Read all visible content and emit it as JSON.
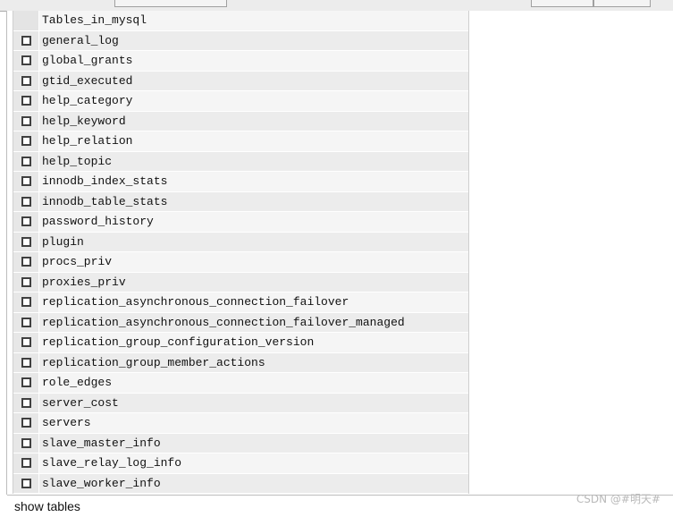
{
  "table": {
    "header": "Tables_in_mysql",
    "rows": [
      "general_log",
      "global_grants",
      "gtid_executed",
      "help_category",
      "help_keyword",
      "help_relation",
      "help_topic",
      "innodb_index_stats",
      "innodb_table_stats",
      "password_history",
      "plugin",
      "procs_priv",
      "proxies_priv",
      "replication_asynchronous_connection_failover",
      "replication_asynchronous_connection_failover_managed",
      "replication_group_configuration_version",
      "replication_group_member_actions",
      "role_edges",
      "server_cost",
      "servers",
      "slave_master_info",
      "slave_relay_log_info",
      "slave_worker_info"
    ]
  },
  "status": {
    "query": "show tables"
  },
  "watermark": "CSDN @#明天#"
}
